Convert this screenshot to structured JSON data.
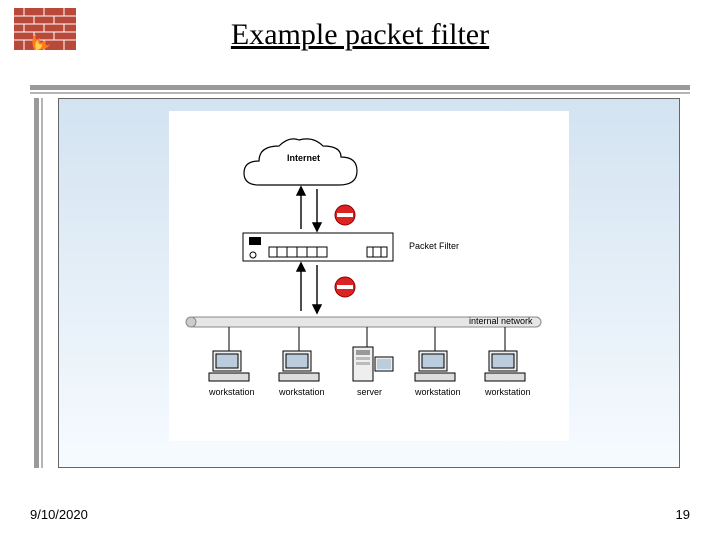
{
  "title": "Example packet filter",
  "date": "9/10/2020",
  "page": "19",
  "diagram": {
    "cloud_label": "Internet",
    "filter_label": "Packet Filter",
    "network_label": "internal network",
    "nodes": [
      "workstation",
      "workstation",
      "server",
      "workstation",
      "workstation"
    ]
  }
}
